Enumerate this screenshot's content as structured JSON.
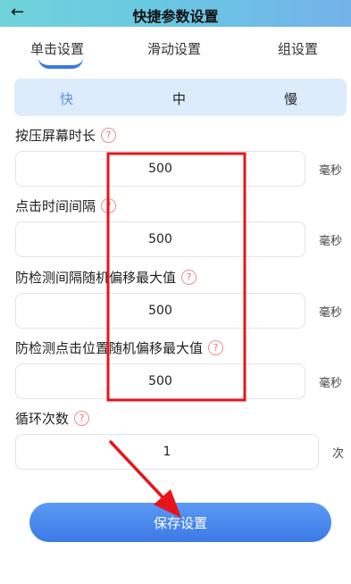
{
  "header": {
    "back_icon": "arrow-left-icon",
    "title": "快捷参数设置"
  },
  "tabs": [
    {
      "label": "单击设置",
      "active": true
    },
    {
      "label": "滑动设置",
      "active": false
    },
    {
      "label": "组设置",
      "active": false
    }
  ],
  "speed_options": [
    {
      "label": "快",
      "color": "#5b8fe0"
    },
    {
      "label": "中",
      "color": "#222222"
    },
    {
      "label": "慢",
      "color": "#222222"
    }
  ],
  "fields": [
    {
      "label": "按压屏幕时长",
      "value": "500",
      "unit": "毫秒"
    },
    {
      "label": "点击时间间隔",
      "value": "500",
      "unit": "毫秒"
    },
    {
      "label": "防检测间隔随机偏移最大值",
      "value": "500",
      "unit": "毫秒"
    },
    {
      "label": "防检测点击位置随机偏移最大值",
      "value": "500",
      "unit": "毫秒"
    },
    {
      "label": "循环次数",
      "value": "1",
      "unit": "次"
    }
  ],
  "help_glyph": "?",
  "save_button": "保存设置",
  "colors": {
    "accent": "#3d79e6",
    "highlight_box": "#e8141c",
    "arrow": "#e8141c"
  }
}
